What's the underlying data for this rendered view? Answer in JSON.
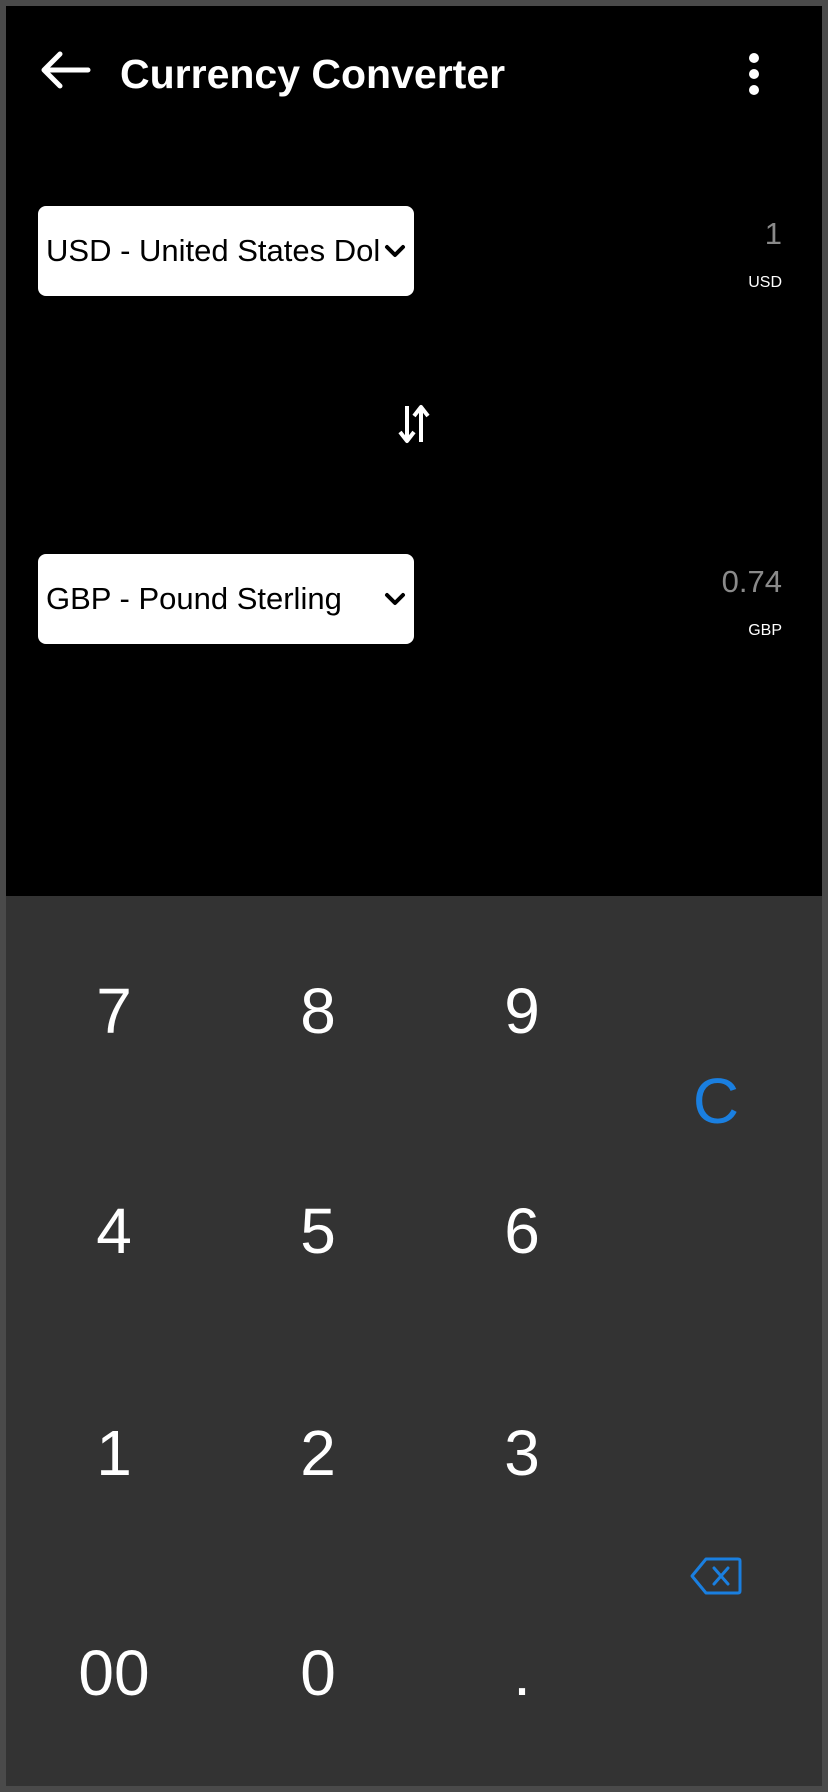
{
  "header": {
    "title": "Currency Converter",
    "back_icon": "arrow-left-icon",
    "menu_icon": "more-vertical-icon"
  },
  "from": {
    "selected": "USD - United States Dollar",
    "amount": "1",
    "code": "USD"
  },
  "to": {
    "selected": "GBP - Pound Sterling",
    "amount": "0.74",
    "code": "GBP"
  },
  "swap_icon": "swap-vertical-icon",
  "keypad": {
    "keys": [
      "7",
      "8",
      "9",
      "4",
      "5",
      "6",
      "1",
      "2",
      "3",
      "00",
      "0",
      "."
    ],
    "clear_label": "C",
    "backspace_icon": "backspace-icon",
    "accent_color": "#1a7fe0"
  }
}
